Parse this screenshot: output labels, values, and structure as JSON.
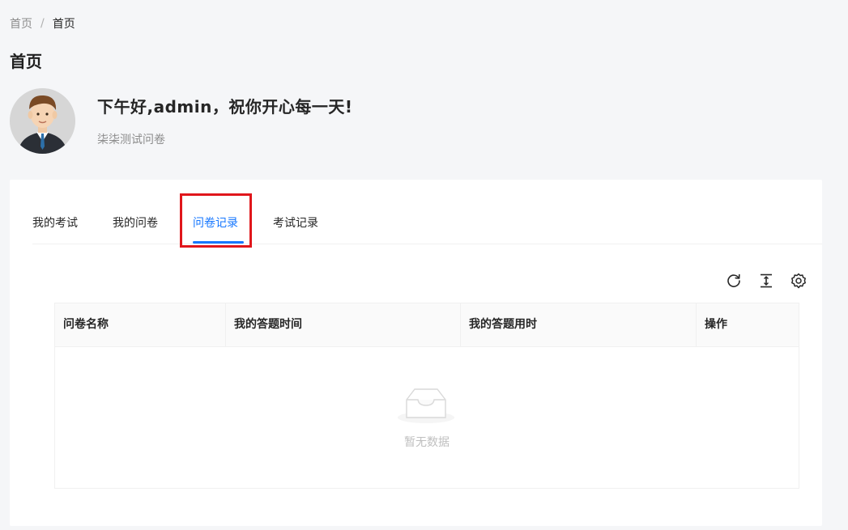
{
  "breadcrumb": {
    "root": "首页",
    "separator": "/",
    "current": "首页"
  },
  "page": {
    "title": "首页"
  },
  "user": {
    "greeting": "下午好,admin，祝你开心每一天!",
    "subtitle": "柒柒测试问卷"
  },
  "tabs": [
    {
      "label": "我的考试"
    },
    {
      "label": "我的问卷"
    },
    {
      "label": "问卷记录",
      "active": true
    },
    {
      "label": "考试记录"
    }
  ],
  "toolbar": {
    "icons": [
      "reload-icon",
      "column-height-icon",
      "setting-icon"
    ]
  },
  "table": {
    "columns": [
      "问卷名称",
      "我的答题时间",
      "我的答题用时",
      "操作"
    ],
    "rows": [],
    "empty_text": "暂无数据"
  },
  "colors": {
    "accent": "#1677ff",
    "highlight": "#e0161b"
  }
}
